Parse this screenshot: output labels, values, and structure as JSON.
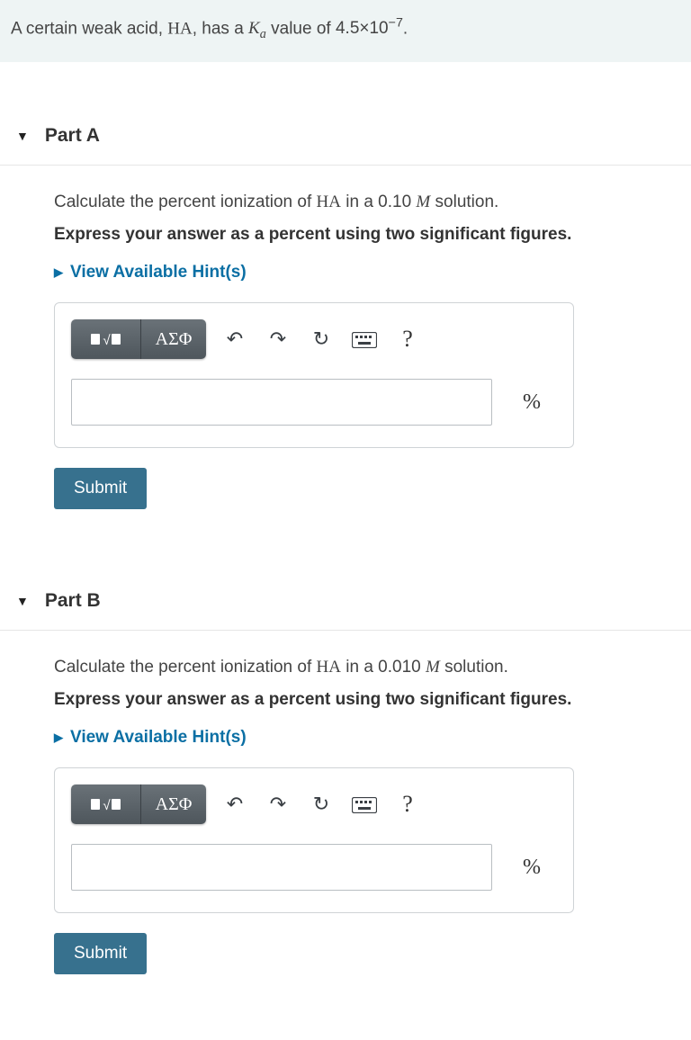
{
  "intro": {
    "pre": "A certain weak acid, ",
    "acid": "HA",
    "mid": ", has a ",
    "ka_sym": "K",
    "ka_sub": "a",
    "mid2": " value of ",
    "kaval_mant": "4.5×10",
    "kaval_exp": "−7",
    "post": "."
  },
  "parts": [
    {
      "title": "Part A",
      "question_pre": "Calculate the percent ionization of ",
      "question_acid": "HA",
      "question_mid": " in a 0.10 ",
      "question_unit": "M",
      "question_post": " solution.",
      "instruction": "Express your answer as a percent using two significant figures.",
      "hints_label": "View Available Hint(s)",
      "greek_label": "ΑΣΦ",
      "unit": "%",
      "submit": "Submit",
      "help": "?"
    },
    {
      "title": "Part B",
      "question_pre": "Calculate the percent ionization of ",
      "question_acid": "HA",
      "question_mid": " in a 0.010 ",
      "question_unit": "M",
      "question_post": " solution.",
      "instruction": "Express your answer as a percent using two significant figures.",
      "hints_label": "View Available Hint(s)",
      "greek_label": "ΑΣΦ",
      "unit": "%",
      "submit": "Submit",
      "help": "?"
    }
  ]
}
